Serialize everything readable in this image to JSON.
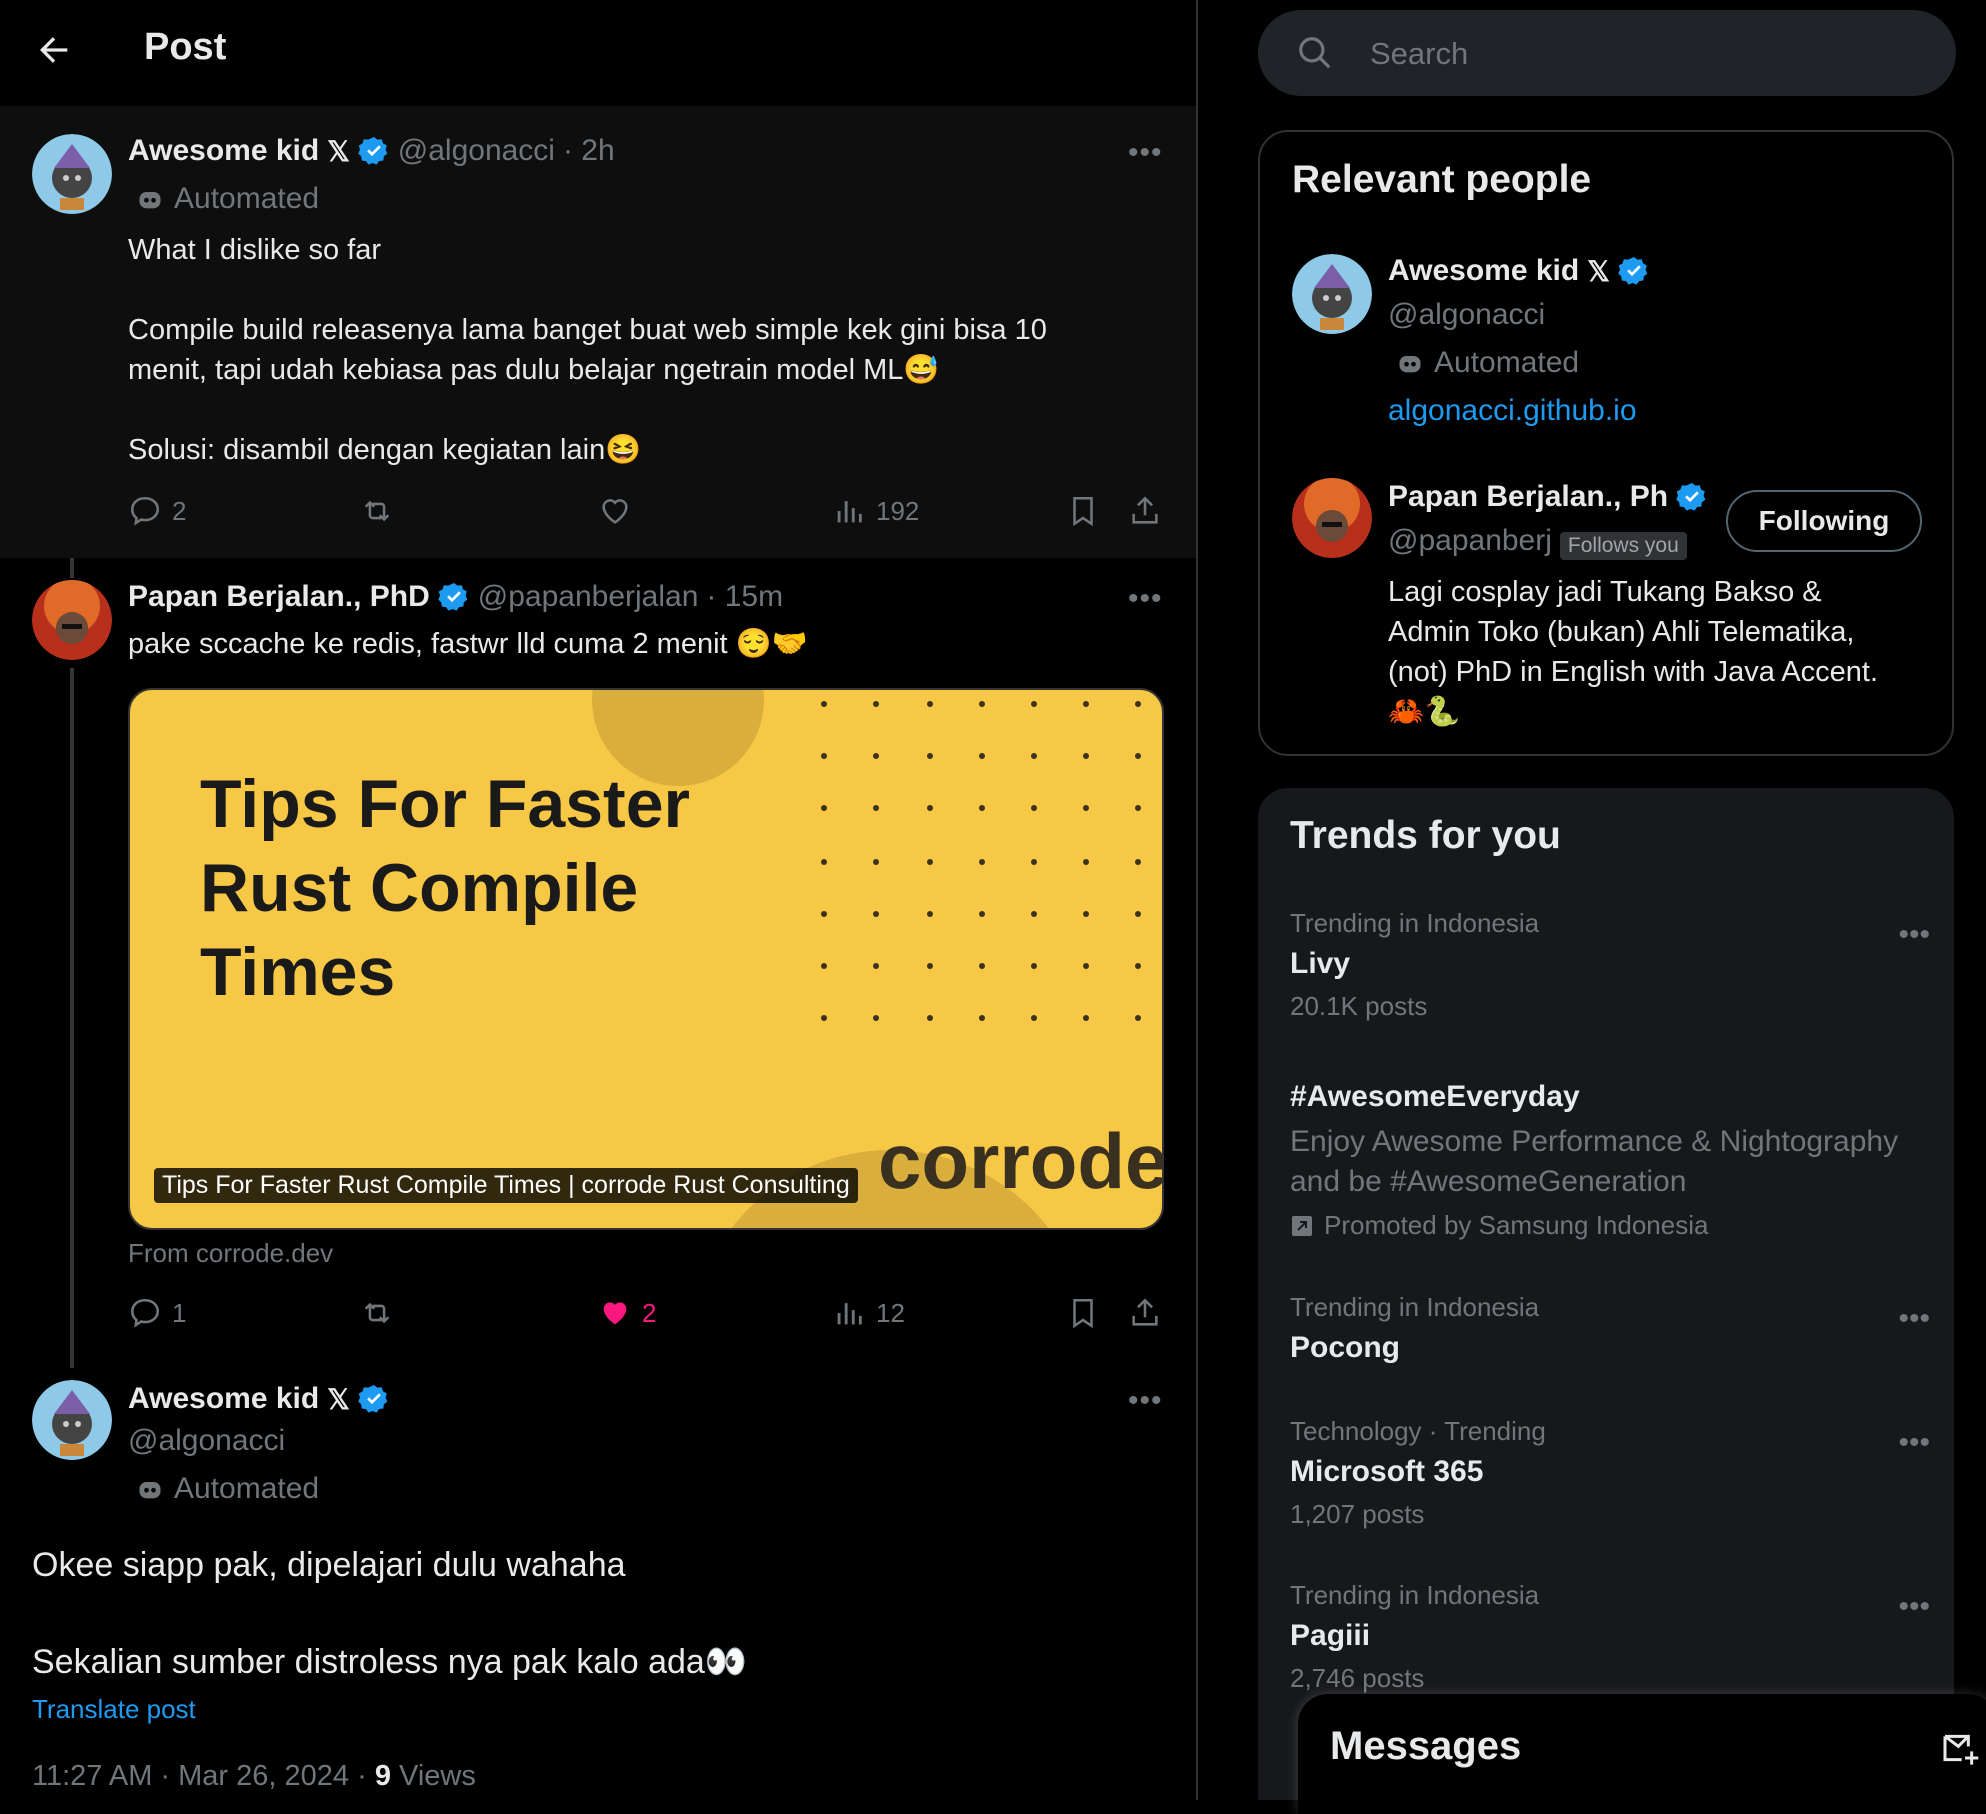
{
  "header": {
    "title": "Post"
  },
  "tweets": [
    {
      "name": "Awesome kid",
      "handle": "@algonacci",
      "time": "· 2h",
      "automated": "Automated",
      "text": "What I dislike so far\n\nCompile build releasenya lama banget buat web simple kek gini bisa 10\nmenit, tapi udah kebiasa pas dulu belajar ngetrain model ML😅\n\nSolusi: disambil dengan kegiatan lain😆",
      "replies": "2",
      "reposts": "",
      "likes": "",
      "views": "192"
    },
    {
      "name": "Papan Berjalan., PhD",
      "handle": "@papanberjalan",
      "time": "· 15m",
      "text": "pake sccache ke redis, fastwr lld cuma 2 menit 😌🤝",
      "card": {
        "title": "Tips For Faster\nRust Compile\nTimes",
        "caption": "Tips For Faster Rust Compile Times | corrode Rust Consulting",
        "brand": "corrode",
        "source": "From corrode.dev"
      },
      "replies": "1",
      "reposts": "",
      "likes": "2",
      "views": "12"
    },
    {
      "name": "Awesome kid",
      "handle": "@algonacci",
      "automated": "Automated",
      "text_line1": "Okee siapp pak, dipelajari dulu wahaha",
      "text_line2": "Sekalian sumber distroless nya pak kalo ada👀",
      "translate": "Translate post",
      "timestamp": "11:27 AM · Mar 26, 2024 · ",
      "views_count": "9",
      "views_label": " Views"
    }
  ],
  "search": {
    "placeholder": "Search"
  },
  "relevant_people": {
    "title": "Relevant people",
    "people": [
      {
        "name": "Awesome kid",
        "handle": "@algonacci",
        "automated": "Automated",
        "link": "algonacci.github.io"
      },
      {
        "name": "Papan Berjalan., Ph",
        "handle": "@papanberj",
        "follows_you": "Follows you",
        "button": "Following",
        "bio": "Lagi cosplay jadi Tukang Bakso &\nAdmin Toko (bukan) Ahli Telematika,\n(not) PhD in English with Java Accent.\n🦀🐍"
      }
    ]
  },
  "trends": {
    "title": "Trends for you",
    "items": [
      {
        "context": "Trending in Indonesia",
        "name": "Livy",
        "posts": "20.1K posts"
      },
      {
        "name": "#AwesomeEveryday",
        "description": "Enjoy Awesome Performance & Nightography\nand be #AwesomeGeneration",
        "promoted": "Promoted by Samsung Indonesia"
      },
      {
        "context": "Trending in Indonesia",
        "name": "Pocong"
      },
      {
        "context": "Technology · Trending",
        "name": "Microsoft 365",
        "posts": "1,207 posts"
      },
      {
        "context": "Trending in Indonesia",
        "name": "Pagiii",
        "posts": "2,746 posts"
      }
    ]
  },
  "messages": {
    "title": "Messages"
  },
  "colors": {
    "accent": "#1d9bf0",
    "like": "#f91880",
    "card_bg": "#f7c846",
    "muted": "#71767b"
  }
}
